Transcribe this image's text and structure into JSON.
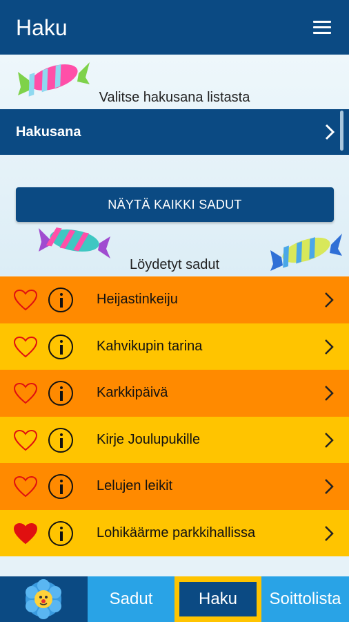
{
  "header": {
    "title": "Haku",
    "menu_icon": "hamburger-menu-icon"
  },
  "search": {
    "instruction": "Valitse hakusana listasta",
    "keyword_label": "Hakusana",
    "show_all_label": "NÄYTÄ KAIKKI SADUT",
    "found_title": "Löydetyt sadut"
  },
  "stories": [
    {
      "title": "Heijastinkeiju",
      "favorite": false
    },
    {
      "title": "Kahvikupin tarina",
      "favorite": false
    },
    {
      "title": "Karkkipäivä",
      "favorite": false
    },
    {
      "title": "Kirje Joulupukille",
      "favorite": false
    },
    {
      "title": "Lelujen leikit",
      "favorite": false
    },
    {
      "title": "Lohikäärme parkkihallissa",
      "favorite": true
    }
  ],
  "bottom_nav": {
    "sadut": "Sadut",
    "haku": "Haku",
    "soittolista": "Soittolista"
  },
  "colors": {
    "primary": "#0b4a83",
    "row_orange": "#ff8a00",
    "row_yellow": "#ffc400",
    "nav_blue": "#29a3e6",
    "heart_red": "#e01010"
  }
}
